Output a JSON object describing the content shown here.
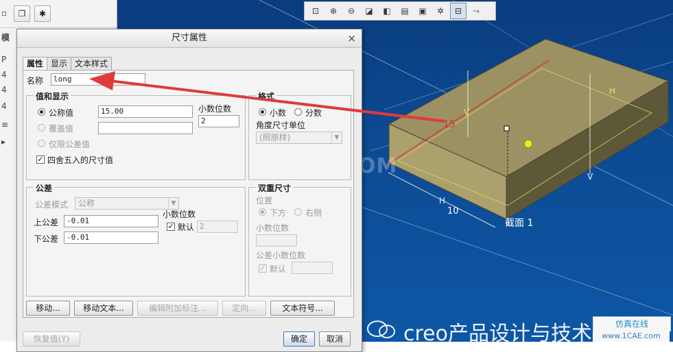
{
  "viewport": {
    "model": {
      "dim_length": "15",
      "dim_width": "10",
      "section_label": "截面 1",
      "h_label": "H",
      "v_label": "V"
    },
    "toolbar_icons": [
      "zoom-window-icon",
      "zoom-in-icon",
      "zoom-out-icon",
      "repaint-icon",
      "shading-icon",
      "saved-views-icon",
      "display-style-icon",
      "datum-planes-icon",
      "annotation-display-icon",
      "spin-center-icon"
    ],
    "watermark": "1CAE.COM"
  },
  "left_panel": {
    "glyphs": [
      "▫",
      "模",
      "P",
      "4",
      "4",
      "4",
      "≡",
      "▸"
    ]
  },
  "dialog": {
    "title": "尺寸属性",
    "tabs": [
      {
        "label": "属性"
      },
      {
        "label": "显示"
      },
      {
        "label": "文本样式"
      }
    ],
    "name_label": "名称",
    "name_value": "long",
    "value_display": {
      "title": "值和显示",
      "nominal_label": "公称值",
      "nominal_value": "15.00",
      "override_label": "覆盖值",
      "override_value": "",
      "tol_only_label": "仅限公差值",
      "round_label": "四舍五入的尺寸值",
      "decimals_label": "小数位数",
      "decimals_value": "2"
    },
    "format": {
      "title": "格式",
      "decimal_label": "小数",
      "fraction_label": "分数",
      "angle_unit_label": "角度尺寸单位",
      "angle_unit_value": "(照原样)"
    },
    "tolerance": {
      "title": "公差",
      "mode_label": "公差模式",
      "mode_value": "公称",
      "upper_label": "上公差",
      "upper_value": "-0.01",
      "lower_label": "下公差",
      "lower_value": "-0.01",
      "decimals_label": "小数位数",
      "default_label": "默认",
      "default_value": "2"
    },
    "dual": {
      "title": "双重尺寸",
      "position_label": "位置",
      "below_label": "下方",
      "right_label": "右侧",
      "decimals_label": "小数位数",
      "tol_decimals_label": "公差小数位数",
      "default_label": "默认"
    },
    "buttons": {
      "move": "移动...",
      "move_text": "移动文本...",
      "edit_attached": "编辑附加标注...",
      "orient": "定向...",
      "text_symbol": "文本符号...",
      "restore": "恢复值(Y)",
      "ok": "确定",
      "cancel": "取消"
    }
  },
  "branding": {
    "text": "creo产品设计与技术交流",
    "site_name": "仿真在线",
    "site_url": "www.1CAE.com"
  }
}
